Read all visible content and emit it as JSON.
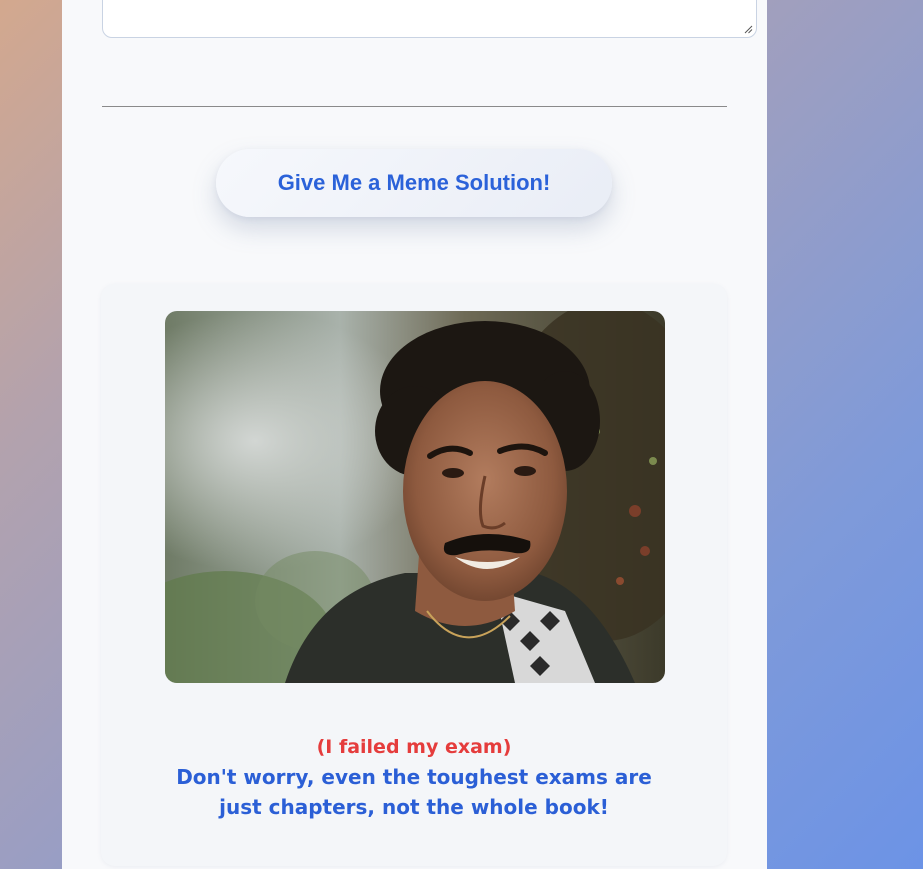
{
  "form": {
    "submit_label": "Give Me a Meme Solution!"
  },
  "result": {
    "problem": "(I failed my exam)",
    "solution": "Don't worry, even the toughest exams are just chapters, not the whole book!",
    "image_icon": "meme-photo-smiling-man"
  },
  "colors": {
    "accent": "#2b62d9",
    "problem": "#e53c3c",
    "panel": "#f4f6f9"
  }
}
